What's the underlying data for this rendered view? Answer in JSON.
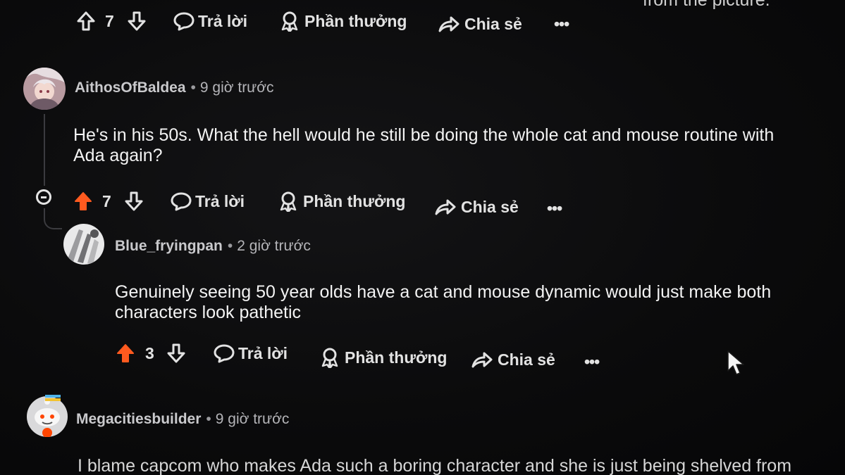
{
  "top_caption_fragment": "from the picture.",
  "actions": {
    "reply_label": "Trả lời",
    "award_label": "Phần thưởng",
    "share_label": "Chia sẻ",
    "more_label": "•••"
  },
  "comments": [
    {
      "vote_count": "7",
      "upvoted": false
    },
    {
      "username": "AithosOfBaldea",
      "separator": "•",
      "time": "9 giờ trước",
      "body_lines": [
        "He's in his 50s. What the hell would he still be doing the whole cat and mouse routine with",
        "Ada again?"
      ],
      "vote_count": "7",
      "upvoted": true
    },
    {
      "username": "Blue_fryingpan",
      "separator": "•",
      "time": "2 giờ trước",
      "body_lines": [
        "Genuinely seeing 50 year olds have a cat and mouse dynamic would just make both",
        "characters look pathetic"
      ],
      "vote_count": "3",
      "upvoted": true
    },
    {
      "username": "Megacitiesbuilder",
      "separator": "•",
      "time": "9 giờ trước",
      "body_fragment": "I blame capcom who makes Ada such a boring character and she is just being shelved from"
    }
  ],
  "colors": {
    "background": "#0b0b0c",
    "upvote_active": "#ff5a1f",
    "text_primary": "#f3f3f3",
    "text_muted": "#b4b4b8",
    "thread_line": "#3b3b3f"
  },
  "icons": {
    "upvote": "arrow-up-icon",
    "downvote": "arrow-down-icon",
    "reply": "speech-bubble-icon",
    "award": "award-ribbon-icon",
    "share": "share-arrow-icon",
    "more": "more-dots-icon",
    "collapse": "collapse-minus-icon",
    "cursor": "mouse-pointer-icon"
  }
}
